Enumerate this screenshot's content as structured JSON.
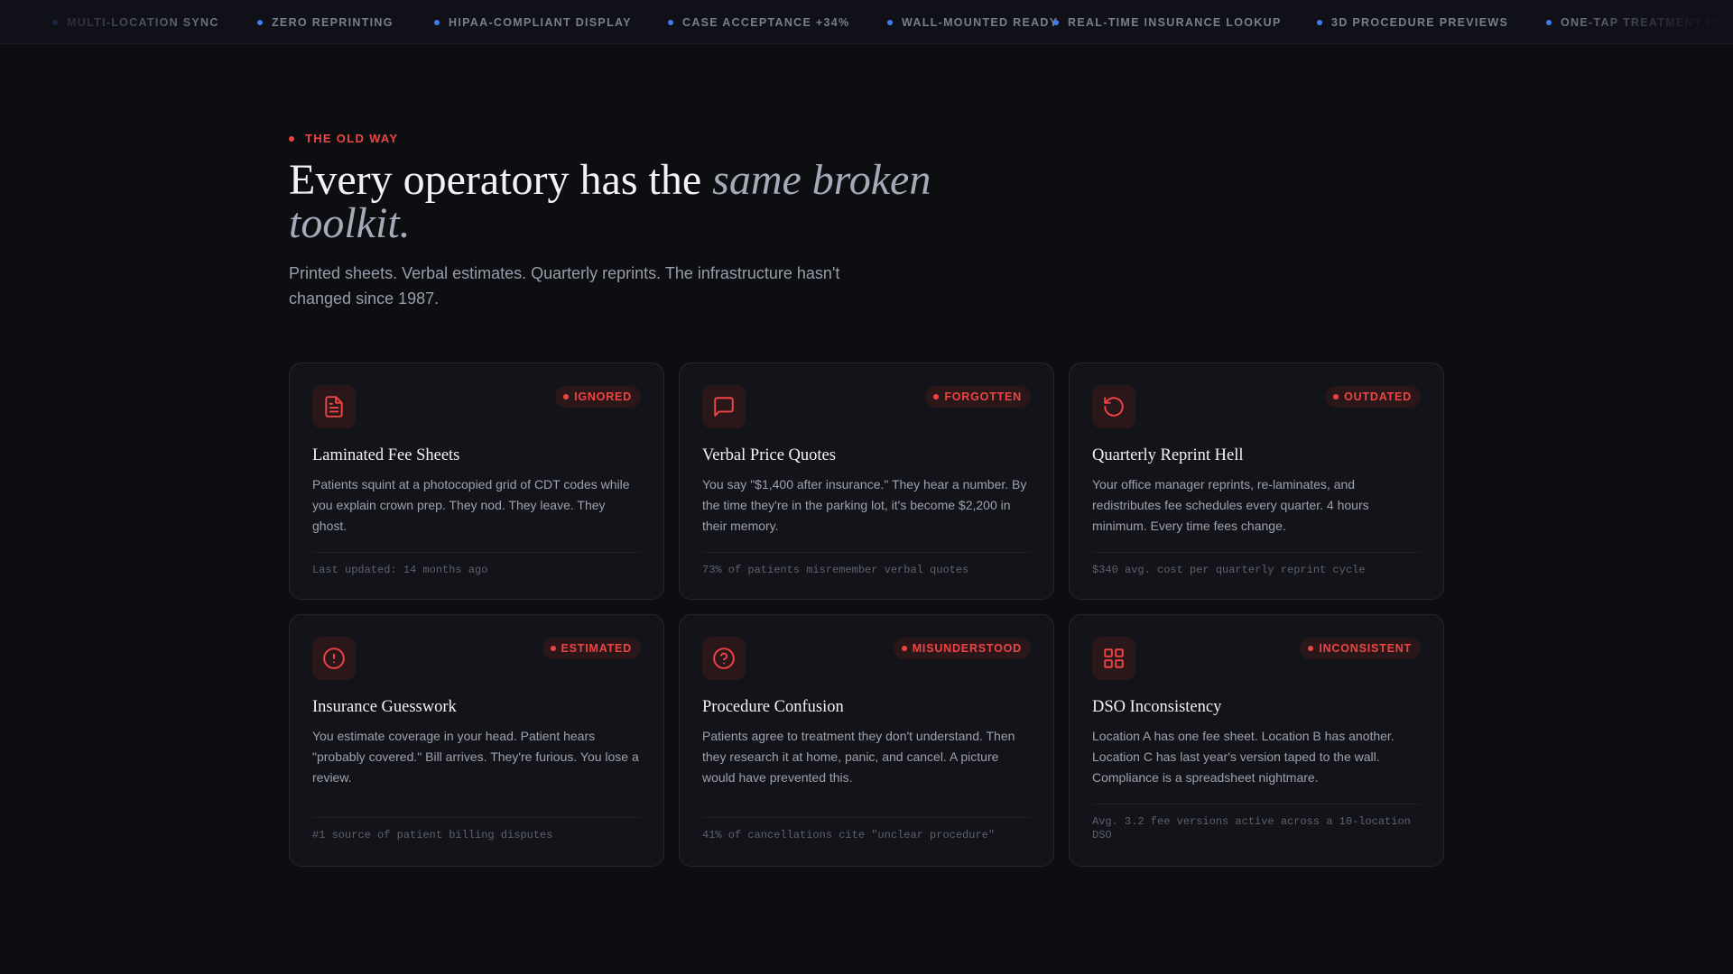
{
  "marquee": {
    "items": [
      "MULTI-LOCATION SYNC",
      "ZERO REPRINTING",
      "HIPAA-COMPLIANT DISPLAY",
      "CASE ACCEPTANCE +34%",
      "WALL-MOUNTED READY",
      "REAL-TIME INSURANCE LOOKUP",
      "3D PROCEDURE PREVIEWS",
      "ONE-TAP TREATMENT PL"
    ]
  },
  "section": {
    "eyebrow": "THE OLD WAY",
    "headline_plain": "Every operatory has the ",
    "headline_accent": "same broken toolkit.",
    "lede": "Printed sheets. Verbal estimates. Quarterly reprints. The infrastructure hasn't changed since 1987."
  },
  "cards": [
    {
      "icon": "document-icon",
      "badge": "IGNORED",
      "title": "Laminated Fee Sheets",
      "body": "Patients squint at a photocopied grid of CDT codes while you explain crown prep. They nod. They leave. They ghost.",
      "footer": "Last updated: 14 months ago"
    },
    {
      "icon": "chat-bubble-icon",
      "badge": "FORGOTTEN",
      "title": "Verbal Price Quotes",
      "body": "You say \"$1,400 after insurance.\" They hear a number. By the time they're in the parking lot, it's become $2,200 in their memory.",
      "footer": "73% of patients misremember verbal quotes"
    },
    {
      "icon": "refresh-icon",
      "badge": "OUTDATED",
      "title": "Quarterly Reprint Hell",
      "body": "Your office manager reprints, re-laminates, and redistributes fee schedules every quarter. 4 hours minimum. Every time fees change.",
      "footer": "$340 avg. cost per quarterly reprint cycle"
    },
    {
      "icon": "alert-circle-icon",
      "badge": "ESTIMATED",
      "title": "Insurance Guesswork",
      "body": "You estimate coverage in your head. Patient hears \"probably covered.\" Bill arrives. They're furious. You lose a review.",
      "footer": "#1 source of patient billing disputes"
    },
    {
      "icon": "question-circle-icon",
      "badge": "MISUNDERSTOOD",
      "title": "Procedure Confusion",
      "body": "Patients agree to treatment they don't understand. Then they research it at home, panic, and cancel. A picture would have prevented this.",
      "footer": "41% of cancellations cite \"unclear procedure\""
    },
    {
      "icon": "grid-icon",
      "badge": "INCONSISTENT",
      "title": "DSO Inconsistency",
      "body": "Location A has one fee sheet. Location B has another. Location C has last year's version taped to the wall. Compliance is a spreadsheet nightmare.",
      "footer": "Avg. 3.2 fee versions active across a 10-location DSO"
    }
  ],
  "colors": {
    "accent_red": "#ef4444",
    "marquee_dot_blue": "#3f7cf2",
    "background": "#0d0e12"
  }
}
